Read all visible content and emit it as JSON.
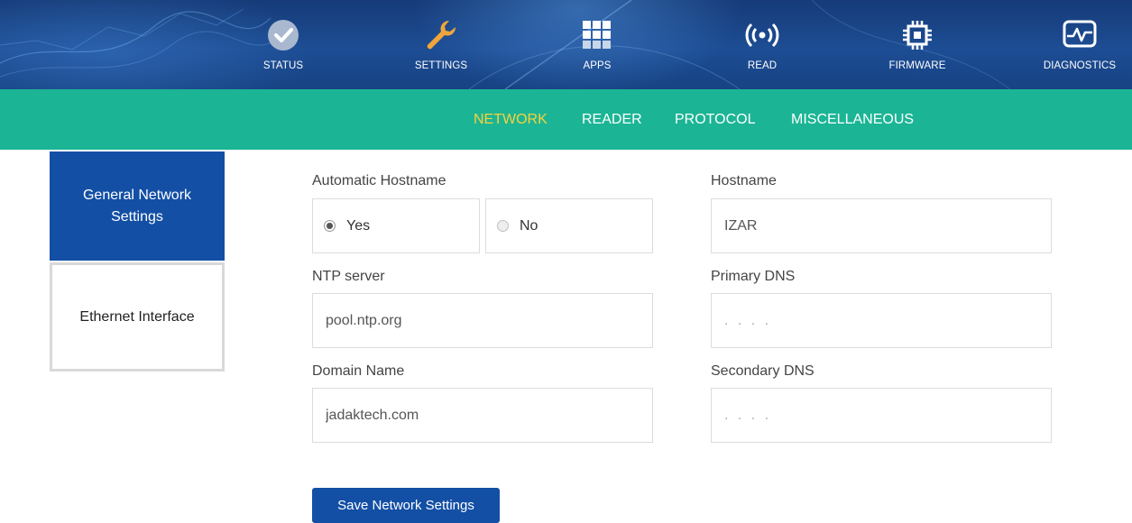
{
  "topnav": {
    "items": [
      {
        "label": "STATUS",
        "icon": "check-circle-icon"
      },
      {
        "label": "SETTINGS",
        "icon": "wrench-icon"
      },
      {
        "label": "APPS",
        "icon": "grid-icon"
      },
      {
        "label": "READ",
        "icon": "broadcast-icon"
      },
      {
        "label": "FIRMWARE",
        "icon": "chip-icon"
      },
      {
        "label": "DIAGNOSTICS",
        "icon": "monitor-pulse-icon"
      }
    ]
  },
  "subnav": {
    "tabs": [
      {
        "label": "NETWORK",
        "active": true
      },
      {
        "label": "READER",
        "active": false
      },
      {
        "label": "PROTOCOL",
        "active": false
      },
      {
        "label": "MISCELLANEOUS",
        "active": false
      }
    ]
  },
  "sidebar": {
    "items": [
      {
        "label": "General Network Settings",
        "active": true
      },
      {
        "label": "Ethernet Interface",
        "active": false
      }
    ]
  },
  "form": {
    "auto_hostname": {
      "label": "Automatic Hostname",
      "options": [
        {
          "label": "Yes",
          "checked": true
        },
        {
          "label": "No",
          "checked": false
        }
      ]
    },
    "hostname": {
      "label": "Hostname",
      "value": "IZAR"
    },
    "ntp_server": {
      "label": "NTP server",
      "value": "pool.ntp.org"
    },
    "primary_dns": {
      "label": "Primary DNS",
      "value": "",
      "placeholder": ". . . ."
    },
    "domain_name": {
      "label": "Domain Name",
      "value": "jadaktech.com"
    },
    "secondary_dns": {
      "label": "Secondary DNS",
      "value": "",
      "placeholder": ". . . ."
    }
  },
  "save_label": "Save Network Settings",
  "colors": {
    "header": "#1d4d94",
    "subnav": "#1bb595",
    "active_tab": "#f7d23c",
    "primary": "#134fa5"
  }
}
